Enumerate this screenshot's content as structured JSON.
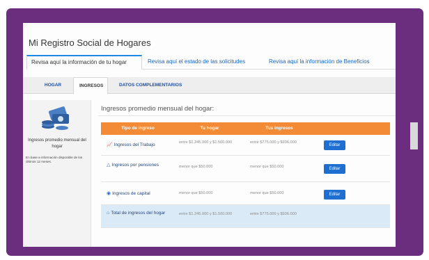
{
  "app": {
    "title": "Mi Registro Social de Hogares"
  },
  "top_tabs": [
    {
      "label": "Revisa aquí la información de tu hogar",
      "active": true
    },
    {
      "label": "Revisa aquí el estado de las solicitudes",
      "active": false
    },
    {
      "label": "Revisa aquí la información de Beneficios",
      "active": false
    }
  ],
  "sub_tabs": [
    {
      "label": "HOGAR",
      "active": false
    },
    {
      "label": "INGRESOS",
      "active": true
    },
    {
      "label": "DATOS COMPLEMENTARIOS",
      "active": false
    }
  ],
  "left_panel": {
    "icon": "money-icon",
    "label": "Ingresos promedio mensual del hogar",
    "note": "En base a información disponible de los últimos 12 meses."
  },
  "section": {
    "title": "Ingresos promedio mensual del hogar:"
  },
  "table": {
    "headers": [
      "Tipo de ingreso",
      "Tu hogar",
      "Tus ingresos"
    ],
    "rows": [
      {
        "type": "Ingresos del Trabajo",
        "icon": "chart-icon",
        "hogar": "entre $1.245.000 y $1.500.000",
        "tus": "entre $775.000 y $936.000",
        "button": "Editar"
      },
      {
        "type": "Ingresos por pensiones",
        "icon": "pension-icon",
        "hogar": "menor que $50.000",
        "tus": "menor que $50.000",
        "button": "Editar"
      },
      {
        "type": "Ingresos de capital",
        "icon": "money-bill-icon",
        "hogar": "menor que $50.000",
        "tus": "menor que $50.000",
        "button": "Editar"
      }
    ],
    "total": {
      "type": "Total de ingresos del hogar",
      "icon": "home-icon",
      "hogar": "entre $1.245.000 y $1.500.000",
      "tus": "entre $775.000 y $936.000"
    }
  },
  "colors": {
    "frame": "#6b2e7e",
    "accent": "#1e6fd0",
    "table_header": "#f28a36",
    "total_row": "#dbeaf7"
  }
}
